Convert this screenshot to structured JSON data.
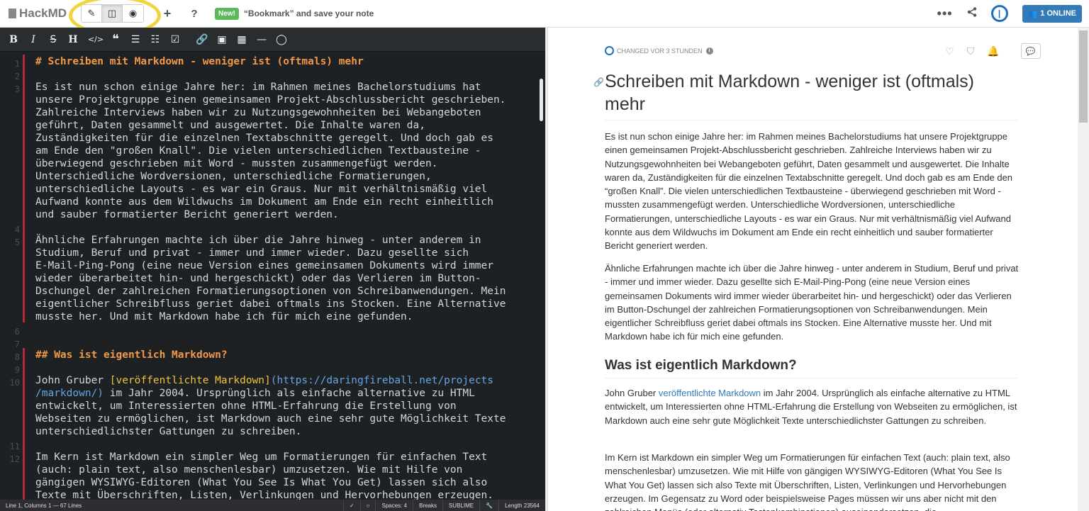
{
  "navbar": {
    "brand": "HackMD",
    "new_badge": "New!",
    "bookmark_text": "“Bookmark” and save your note",
    "online_label": "1 ONLINE",
    "menu_dots": "•••"
  },
  "toolbar": {
    "bold": "B",
    "italic": "I",
    "strike": "S",
    "heading": "H"
  },
  "editor": {
    "lines": [
      {
        "n": "1",
        "text": "# Schreiben mit Markdown - weniger ist (oftmals) mehr"
      },
      {
        "n": "3",
        "l1": "Es ist nun schon einige Jahre her: im Rahmen meines Bachelorstudiums hat",
        "l2": "unsere Projektgruppe einen gemeinsamen Projekt-Abschlussbericht geschrieben.",
        "l3": "Zahlreiche Interviews haben wir zu Nutzungsgewohnheiten bei Webangeboten",
        "l4": "geführt, Daten gesammelt und ausgewertet. Die Inhalte waren da,",
        "l5": "Zuständigkeiten für die einzelnen Textabschnitte geregelt. Und doch gab es",
        "l6": "am Ende den \"großen Knall\". Die vielen unterschiedlichen Textbausteine -",
        "l7": "überwiegend geschrieben mit Word - mussten zusammengefügt werden.",
        "l8": "Unterschiedliche Wordversionen, unterschiedliche Formatierungen,",
        "l9": "unterschiedliche Layouts - es war ein Graus. Nur mit verhältnismäßig viel",
        "l10": "Aufwand konnte aus dem Wildwuchs im Dokument am Ende ein recht einheitlich",
        "l11": "und sauber formatierter Bericht generiert werden."
      },
      {
        "n": "5",
        "l1": "Ähnliche Erfahrungen machte ich über die Jahre hinweg - unter anderem in",
        "l2": "Studium, Beruf und privat - immer und immer wieder. Dazu gesellte sich",
        "l3": "E-Mail-Ping-Pong (eine neue Version eines gemeinsamen Dokuments wird immer",
        "l4": "wieder überarbeitet hin- und hergeschickt) oder das Verlieren im Button-",
        "l5": "Dschungel der zahlreichen Formatierungsoptionen von Schreibanwendungen. Mein",
        "l6": "eigentlicher Schreibfluss geriet dabei oftmals ins Stocken. Eine Alternative",
        "l7": "musste her. Und mit Markdown habe ich für mich eine gefunden."
      },
      {
        "n": "8",
        "text": "## Was ist eigentlich Markdown?"
      },
      {
        "n": "10",
        "pre": "John Gruber ",
        "link": "[veröffentlichte Markdown]",
        "url1": "(https://daringfireball.net/projects",
        "url2": "/markdown/)",
        "post2": " im Jahr 2004. Ursprünglich als einfache alternative zu HTML",
        "l3": "entwickelt, um Interessierten ohne HTML-Erfahrung die Erstellung von",
        "l4": "Webseiten zu ermöglichen, ist Markdown auch eine sehr gute Möglichkeit Texte",
        "l5": "unterschiedlichster Gattungen zu schreiben."
      },
      {
        "n": "12",
        "l1": "Im Kern ist Markdown ein simpler Weg um Formatierungen für einfachen Text",
        "l2": "(auch: plain text, also menschenlesbar) umzusetzen. Wie mit Hilfe von",
        "l3": "gängigen WYSIWYG-Editoren (What You See Is What You Get) lassen sich also",
        "l4": "Texte mit Überschriften, Listen, Verlinkungen und Hervorhebungen erzeugen."
      }
    ],
    "gutter": [
      "1",
      "2",
      "3",
      "4",
      "5",
      "6",
      "7",
      "8",
      "9",
      "10",
      "11",
      "12"
    ]
  },
  "statusbar": {
    "position": "Line 1, Columns 1 — 67 Lines",
    "spaces": "Spaces: 4",
    "breaks": "Breaks",
    "keymap": "SUBLIME",
    "length": "Length 23564"
  },
  "preview": {
    "changed": "CHANGED VOR 3 STUNDEN",
    "title": "Schreiben mit Markdown - weniger ist (oftmals) mehr",
    "para1": "Es ist nun schon einige Jahre her: im Rahmen meines Bachelorstudiums hat unsere Projektgruppe einen gemeinsamen Projekt-Abschlussbericht geschrieben. Zahlreiche Interviews haben wir zu Nutzungsgewohnheiten bei Webangeboten geführt, Daten gesammelt und ausgewertet. Die Inhalte waren da, Zuständigkeiten für die einzelnen Textabschnitte geregelt. Und doch gab es am Ende den “großen Knall”. Die vielen unterschiedlichen Textbausteine - überwiegend geschrieben mit Word - mussten zusammengefügt werden. Unterschiedliche Wordversionen, unterschiedliche Formatierungen, unterschiedliche Layouts - es war ein Graus. Nur mit verhältnismäßig viel Aufwand konnte aus dem Wildwuchs im Dokument am Ende ein recht einheitlich und sauber formatierter Bericht generiert werden.",
    "para2": "Ähnliche Erfahrungen machte ich über die Jahre hinweg - unter anderem in Studium, Beruf und privat - immer und immer wieder. Dazu gesellte sich E-Mail-Ping-Pong (eine neue Version eines gemeinsamen Dokuments wird immer wieder überarbeitet hin- und hergeschickt) oder das Verlieren im Button-Dschungel der zahlreichen Formatierungsoptionen von Schreibanwendungen. Mein eigentlicher Schreibfluss geriet dabei oftmals ins Stocken. Eine Alternative musste her. Und mit Markdown habe ich für mich eine gefunden.",
    "h2": "Was ist eigentlich Markdown?",
    "para3_pre": "John Gruber ",
    "para3_link": "veröffentlichte Markdown",
    "para3_post": " im Jahr 2004. Ursprünglich als einfache alternative zu HTML entwickelt, um Interessierten ohne HTML-Erfahrung die Erstellung von Webseiten zu ermöglichen, ist Markdown auch eine sehr gute Möglichkeit Texte unterschiedlichster Gattungen zu schreiben.",
    "para4": "Im Kern ist Markdown ein simpler Weg um Formatierungen für einfachen Text (auch: plain text, also menschenlesbar) umzusetzen. Wie mit Hilfe von gängigen WYSIWYG-Editoren (What You See Is What You Get) lassen sich also Texte mit Überschriften, Listen, Verlinkungen und Hervorhebungen erzeugen. Im Gegensatz zu Word oder beispielsweise Pages müssen wir uns aber nicht mit den zahlreichen Menüs (oder alternativ Tastenkombinationen) auseinandersetzen, die"
  },
  "colors": {
    "accent": "#337ab7",
    "editor_bg": "#1e2124",
    "heading": "#f29849",
    "highlight": "#f2d33a"
  }
}
